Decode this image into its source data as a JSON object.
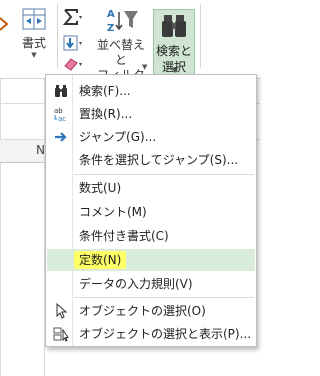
{
  "ribbon": {
    "format_label": "書式",
    "sort_filter_line1": "並べ替えと",
    "sort_filter_line2": "フィルター",
    "find_select_line1": "検索と",
    "find_select_line2": "選択"
  },
  "menu": {
    "items": [
      {
        "label": "検索(F)..."
      },
      {
        "label": "置換(R)..."
      },
      {
        "label": "ジャンプ(G)..."
      },
      {
        "label": "条件を選択してジャンプ(S)..."
      },
      {
        "label": "数式(U)"
      },
      {
        "label": "コメント(M)"
      },
      {
        "label": "条件付き書式(C)"
      },
      {
        "label": "定数(N)"
      },
      {
        "label": "データの入力規則(V)"
      },
      {
        "label": "オブジェクトの選択(O)"
      },
      {
        "label": "オブジェクトの選択と表示(P)..."
      }
    ],
    "highlighted": "定数(N)"
  },
  "sheet": {
    "column_label": "N"
  },
  "colors": {
    "selected_button_bg": "#cfe5d2",
    "hover_item_bg": "#d8ecd9",
    "highlight_marker": "#ffff66"
  }
}
